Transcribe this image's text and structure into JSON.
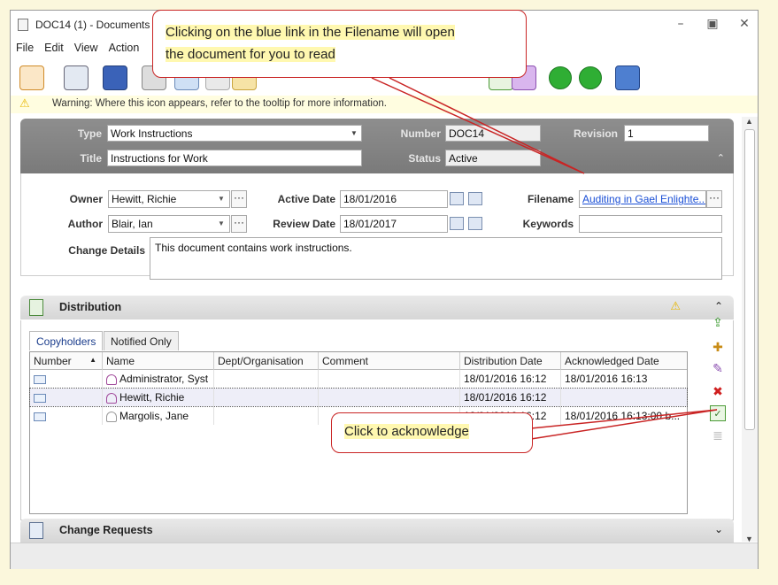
{
  "window": {
    "title": "DOC14 (1) - Documents D"
  },
  "menu": [
    "File",
    "Edit",
    "View",
    "Action"
  ],
  "warning": {
    "text": "Warning: Where this icon appears, refer to the tooltip for more information."
  },
  "header": {
    "type_label": "Type",
    "type_value": "Work Instructions",
    "number_label": "Number",
    "number_value": "DOC14",
    "revision_label": "Revision",
    "revision_value": "1",
    "title_label": "Title",
    "title_value": "Instructions for Work",
    "status_label": "Status",
    "status_value": "Active"
  },
  "form": {
    "owner_label": "Owner",
    "owner_value": "Hewitt, Richie",
    "author_label": "Author",
    "author_value": "Blair, Ian",
    "active_date_label": "Active Date",
    "active_date_value": "18/01/2016",
    "review_date_label": "Review Date",
    "review_date_value": "18/01/2017",
    "filename_label": "Filename",
    "filename_value": "Auditing in Gael Enlighte...",
    "keywords_label": "Keywords",
    "keywords_value": "",
    "change_details_label": "Change Details",
    "change_details_value": "This document contains work instructions."
  },
  "distribution": {
    "title": "Distribution",
    "tabs": [
      "Copyholders",
      "Notified Only"
    ],
    "columns": [
      "Number",
      "Name",
      "Dept/Organisation",
      "Comment",
      "Distribution Date",
      "Acknowledged Date"
    ],
    "rows": [
      {
        "number": "",
        "name": "Administrator, Syst",
        "dept": "",
        "comment": "",
        "dist_date": "18/01/2016 16:12",
        "ack_date": "18/01/2016 16:13"
      },
      {
        "number": "",
        "name": "Hewitt, Richie",
        "dept": "",
        "comment": "",
        "dist_date": "18/01/2016 16:12",
        "ack_date": ""
      },
      {
        "number": "",
        "name": "Margolis, Jane",
        "dept": "",
        "comment": "",
        "dist_date": "18/01/2016 16:12",
        "ack_date": "18/01/2016 16:13:00 b..."
      }
    ]
  },
  "change_requests": {
    "title": "Change Requests"
  },
  "callouts": {
    "top_line1": "Clicking on the blue link in the Filename will open",
    "top_line2": "the document for you to read",
    "bottom": "Click to acknowledge"
  },
  "colors": {
    "background": "#fbf7dc",
    "callout_border": "#c92424",
    "link": "#1a4fd6",
    "header_grey": "#8e8e8e"
  }
}
